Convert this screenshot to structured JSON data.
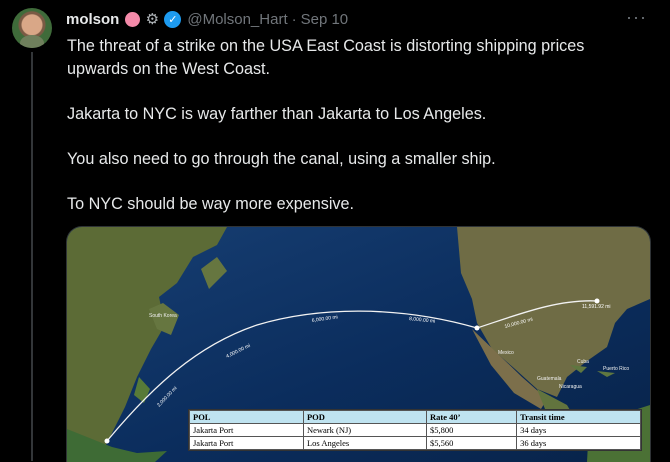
{
  "user": {
    "name": "molson",
    "handle": "@Molson_Hart",
    "separator": "·",
    "date": "Sep 10",
    "emoji_icon": "brain-icon",
    "badge_icon": "gear-badge-icon",
    "verified_icon": "verified-checkmark-icon"
  },
  "post": {
    "paragraphs": [
      "The threat of a strike on the USA East Coast is distorting shipping prices upwards on the West Coast.",
      "Jakarta to NYC is way farther than Jakarta to Los Angeles.",
      "You also need to go through the canal, using a smaller ship.",
      "To NYC should be way more expensive."
    ],
    "more_icon": "more-options-icon"
  },
  "map": {
    "route_labels": [
      "2,000.00 mi",
      "4,000.00 mi",
      "6,000.00 mi",
      "8,000.00 mi",
      "10,000.00 mi",
      "11,591.92 mi"
    ],
    "place_labels": [
      "South Korea",
      "Mexico",
      "Cuba",
      "Puerto Rico",
      "Guatemala",
      "Nicaragua"
    ]
  },
  "table": {
    "headers": [
      "POL",
      "POD",
      "Rate 40’",
      "Transit time"
    ],
    "rows": [
      [
        "Jakarta Port",
        "Newark (NJ)",
        "$5,800",
        "34 days"
      ],
      [
        "Jakarta Port",
        "Los Angeles",
        "$5,560",
        "36 days"
      ]
    ]
  },
  "colors": {
    "background": "#000000",
    "text": "#e7e9ea",
    "muted": "#71767b",
    "verified": "#1d9bf0",
    "table_header": "#bfe3f0"
  }
}
